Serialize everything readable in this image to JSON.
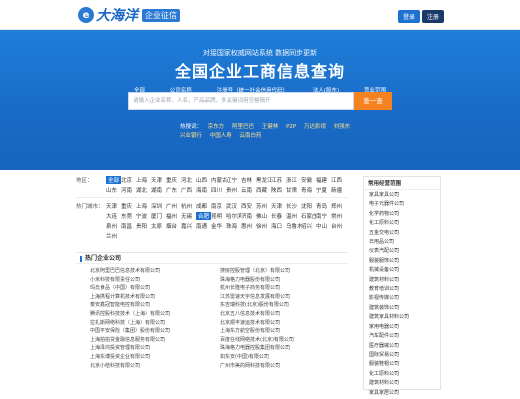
{
  "brand": {
    "logo_glyph": "e",
    "name": "大海洋",
    "sub": "企业征信"
  },
  "auth": {
    "login": "登录",
    "register": "注册"
  },
  "hero": {
    "subtitle": "对接国家权威网站系统 数据同步更新",
    "title": "全国企业工商信息查询",
    "tabs": [
      "全部",
      "公司名称",
      "注册号（统一社会信用代码）",
      "法人(股东)",
      "营业范围"
    ],
    "search_placeholder": "请输入企业名称、人名，产品品牌，多关键词用空格隔开",
    "search_button": "查一查",
    "hot_label": "热搜词：",
    "hot_keywords": [
      "京东方",
      "阿里巴巴",
      "王健林",
      "P2P",
      "万达影视",
      "刘强东",
      "兴业银行",
      "中国人寿",
      "云南白药"
    ]
  },
  "filters": {
    "region_label": "地区：",
    "regions": [
      "全部",
      "北京",
      "上海",
      "天津",
      "重庆",
      "河北",
      "山西",
      "内蒙古",
      "辽宁",
      "吉林",
      "黑龙江",
      "江苏",
      "浙江",
      "安徽",
      "福建",
      "江西",
      "山东",
      "河南",
      "湖北",
      "湖南",
      "广东",
      "广西",
      "海南",
      "四川",
      "贵州",
      "云南",
      "西藏",
      "陕西",
      "甘肃",
      "青海",
      "宁夏",
      "新疆"
    ],
    "city_label": "热门城市：",
    "cities": [
      "天津",
      "重庆",
      "上海",
      "深圳",
      "广州",
      "杭州",
      "成都",
      "南京",
      "武汉",
      "西安",
      "苏州",
      "天津",
      "长沙",
      "沈阳",
      "青岛",
      "郑州",
      "大连",
      "东莞",
      "宁波",
      "厦门",
      "福州",
      "无锡",
      "合肥",
      "昆明",
      "哈尔滨",
      "济南",
      "佛山",
      "长春",
      "温州",
      "石家庄",
      "南宁",
      "常州",
      "泉州",
      "南昌",
      "贵阳",
      "太原",
      "烟台",
      "嘉兴",
      "南通",
      "金华",
      "珠海",
      "惠州",
      "徐州",
      "海口",
      "乌鲁木齐",
      "绍兴",
      "中山",
      "台州",
      "兰州"
    ]
  },
  "list": {
    "heading": "热门企业公司",
    "companies": [
      "北京阿里巴巴信息技术有限公司",
      "搜房控股管理（北京）有限公司",
      "小米科技有限责任公司",
      "珠海格力电器股份有限公司",
      "玛氏食品（中国）有限公司",
      "杭州长隆电子商务有限公司",
      "上海携程计算机技术有限公司",
      "江苏雷速天宇信息发展有限公司",
      "泰安鑫冠智能电控有限公司",
      "东吉瑞科技(北京)股份有限公司",
      "腾讯控股科技技术（上海）有限公司",
      "北京五八信息技术有限公司",
      "拉扎斯网络科技（上海）有限公司",
      "北京顺丰速运技术有限公司",
      "中国平安保险（集团）股份有限公司",
      "上海东方航空股份有限公司",
      "上海拍拍贷金融信息服务有限公司",
      "百度在线网络技术(北京)有限公司",
      "上海泽鸿投资管理有限公司",
      "珠海格力电器控股集团有限公司",
      "上海东博投资企业有限公司",
      "如东安(中国)有限公司",
      "北京小桔科技有限公司",
      "广州市美的网科技有限公司"
    ]
  },
  "side": {
    "heading": "常用经营范围",
    "items": [
      "家具家具公司",
      "电子元器件公司",
      "化学药物公司",
      "化工原料公司",
      "五金交电公司",
      "日用品公司",
      "仪表汽配公司",
      "服装服饰公司",
      "机械设备公司",
      "建筑材料公司",
      "教育培训公司",
      "影视传媒公司",
      "建筑装饰公司",
      "建筑家具材料公司",
      "家用电器公司",
      "汽车配件公司",
      "医疗器械公司",
      "国际贸易公司",
      "服装鞋帽公司",
      "化工原料公司",
      "建筑材料公司",
      "家具家居公司"
    ]
  },
  "colors": {
    "brand_blue": "#1d72d1",
    "search_orange": "#f58220",
    "hero_blue": "#1a6cc8"
  }
}
